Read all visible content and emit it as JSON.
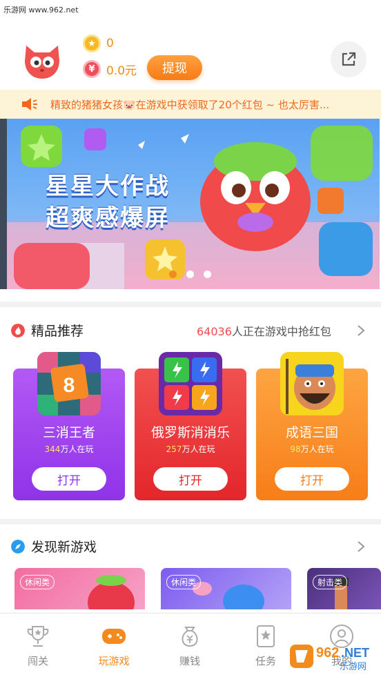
{
  "watermark_top": "乐游网 www.962.net",
  "profile": {
    "coins": "0",
    "money": "0.0元",
    "withdraw_label": "提现",
    "coin_symbol": "★",
    "money_symbol": "¥"
  },
  "notice": {
    "text": "精致的猪猪女孩🐷在游戏中获领取了20个红包 ~ 也太厉害..."
  },
  "banner": {
    "line1": "星星大作战",
    "line2": "超爽感爆屏",
    "dots": 3,
    "active_dot": 0
  },
  "featured": {
    "title": "精品推荐",
    "count": "64036",
    "count_suffix": "人正在游戏中抢红包",
    "games": [
      {
        "name": "三消王者",
        "players_num": "344",
        "players_suffix": "万人在玩",
        "button": "打开",
        "color": "#a146f0"
      },
      {
        "name": "俄罗斯消消乐",
        "players_num": "257",
        "players_suffix": "万人在玩",
        "button": "打开",
        "color": "#ef3b3b"
      },
      {
        "name": "成语三国",
        "players_num": "98",
        "players_suffix": "万人在玩",
        "button": "打开",
        "color": "#fa8f2b"
      }
    ]
  },
  "discover": {
    "title": "发现新游戏",
    "items": [
      {
        "tag": "休闲类"
      },
      {
        "tag": "休闲类"
      },
      {
        "tag": "射击类"
      }
    ]
  },
  "tabs": [
    {
      "label": "闯关",
      "icon": "trophy-icon"
    },
    {
      "label": "玩游戏",
      "icon": "gamepad-icon"
    },
    {
      "label": "赚钱",
      "icon": "money-bag-icon"
    },
    {
      "label": "任务",
      "icon": "task-star-icon"
    },
    {
      "label": "我的",
      "icon": "user-icon"
    }
  ],
  "watermark_logo": {
    "num": "962",
    "net": ".NET",
    "cn": "乐游网"
  },
  "colors": {
    "accent": "#f38a1f",
    "notice_bg": "#fdf4d8",
    "notice_text": "#f0681e",
    "highlight_red": "#f04c4c"
  }
}
